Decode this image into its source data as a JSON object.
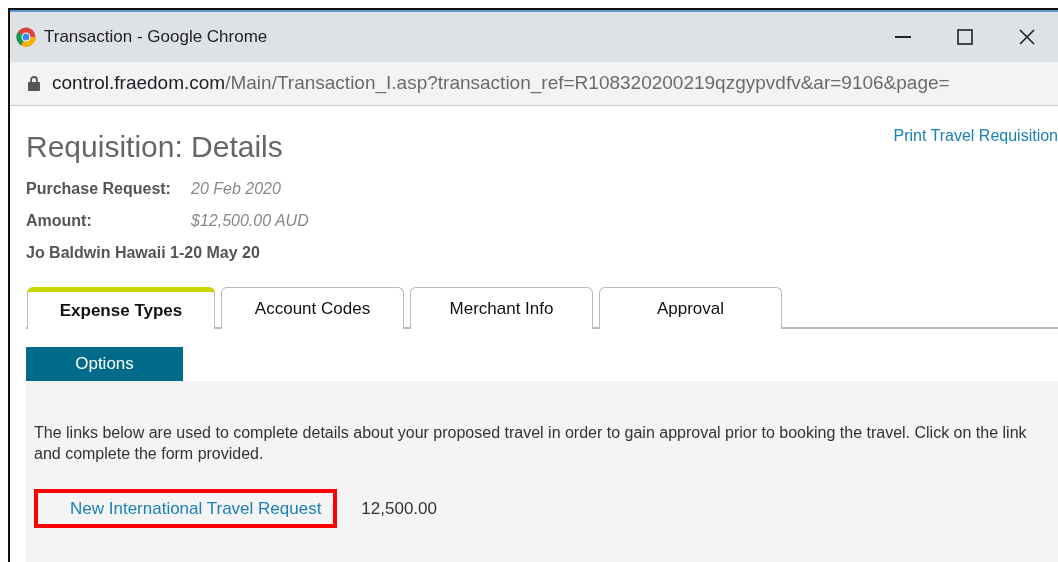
{
  "window": {
    "title": "Transaction - Google Chrome"
  },
  "address_bar": {
    "host": "control.fraedom.com",
    "path": "/Main/Transaction_I.asp?transaction_ref=R108320200219qzgypvdfv&ar=9106&page="
  },
  "page": {
    "heading": "Requisition: Details",
    "print_link": "Print Travel Requisition",
    "fields": [
      {
        "label": "Purchase Request:",
        "value": "20 Feb 2020"
      },
      {
        "label": "Amount:",
        "value": "$12,500.00 AUD"
      }
    ],
    "description": "Jo Baldwin Hawaii 1-20 May 20"
  },
  "tabs": [
    {
      "label": "Expense Types",
      "selected": true
    },
    {
      "label": "Account Codes",
      "selected": false
    },
    {
      "label": "Merchant Info",
      "selected": false
    },
    {
      "label": "Approval",
      "selected": false
    }
  ],
  "options_button": "Options",
  "instructions": "The links below are used to complete details about your proposed travel in order to gain approval prior to booking the travel. Click on the link and complete the form provided.",
  "expense_rows": [
    {
      "link": "New International Travel Request",
      "amount": "12,500.00",
      "highlighted": true
    }
  ]
}
